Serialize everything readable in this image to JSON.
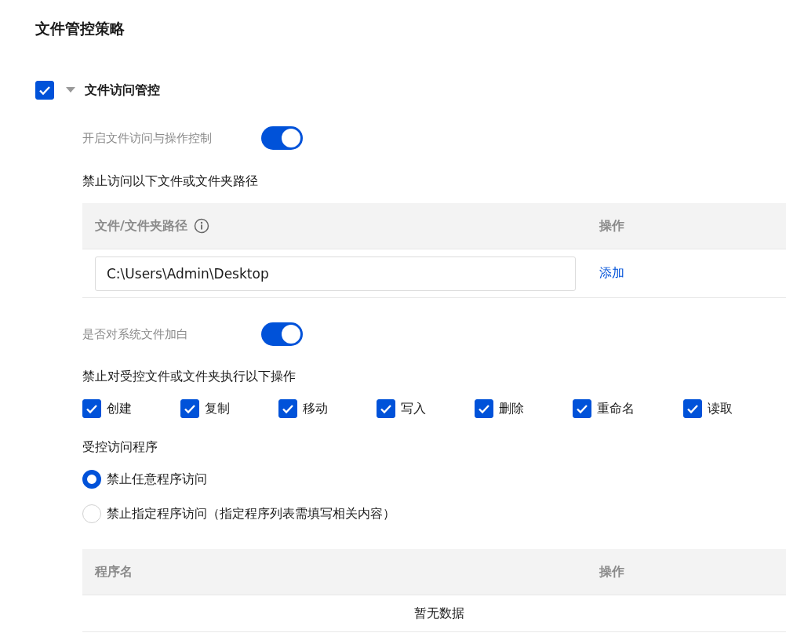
{
  "title": "文件管控策略",
  "section": {
    "label": "文件访问管控",
    "checked": true,
    "expanded": true
  },
  "access_toggle": {
    "label": "开启文件访问与操作控制",
    "on": true
  },
  "path_table": {
    "heading": "禁止访问以下文件或文件夹路径",
    "columns": [
      "文件/文件夹路径",
      "操作"
    ],
    "input_value": "C:\\Users\\Admin\\Desktop",
    "action": "添加"
  },
  "whitelist_toggle": {
    "label": "是否对系统文件加白",
    "on": true
  },
  "operations": {
    "heading": "禁止对受控文件或文件夹执行以下操作",
    "items": [
      {
        "label": "创建",
        "checked": true
      },
      {
        "label": "复制",
        "checked": true
      },
      {
        "label": "移动",
        "checked": true
      },
      {
        "label": "写入",
        "checked": true
      },
      {
        "label": "删除",
        "checked": true
      },
      {
        "label": "重命名",
        "checked": true
      },
      {
        "label": "读取",
        "checked": true
      }
    ]
  },
  "programs": {
    "heading": "受控访问程序",
    "options": [
      {
        "label": "禁止任意程序访问",
        "selected": true
      },
      {
        "label": "禁止指定程序访问（指定程序列表需填写相关内容）",
        "selected": false
      }
    ]
  },
  "program_table": {
    "columns": [
      "程序名",
      "操作"
    ],
    "empty_text": "暂无数据"
  }
}
